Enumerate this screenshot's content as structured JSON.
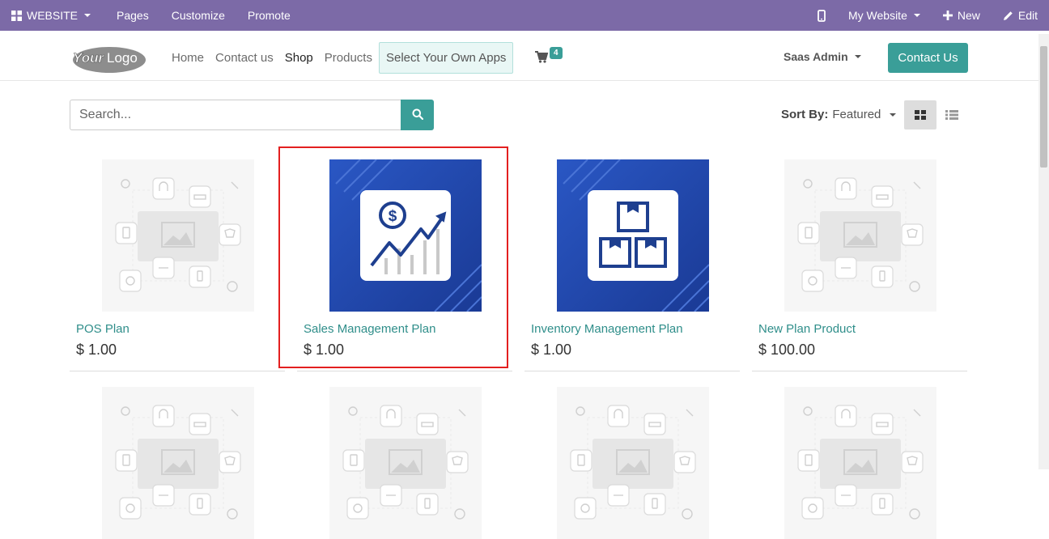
{
  "editbar": {
    "website_label": "WEBSITE",
    "menu": [
      "Pages",
      "Customize",
      "Promote"
    ],
    "my_website": "My Website",
    "new_label": "New",
    "edit_label": "Edit",
    "background": "#7c6aa7"
  },
  "header": {
    "logo_text": "YourLogo",
    "nav": [
      "Home",
      "Contact us",
      "Shop",
      "Products",
      "Select Your Own Apps"
    ],
    "active_nav": "Shop",
    "cart_count": "4",
    "user": "Saas Admin",
    "contact_button": "Contact Us",
    "accent": "#3a9e98"
  },
  "search": {
    "placeholder": "Search..."
  },
  "sort": {
    "label": "Sort By:",
    "value": "Featured"
  },
  "products": [
    {
      "name": "POS Plan",
      "price": "$ 1.00",
      "image": "placeholder"
    },
    {
      "name": "Sales Management Plan",
      "price": "$ 1.00",
      "image": "sales-chart-icon"
    },
    {
      "name": "Inventory Management Plan",
      "price": "$ 1.00",
      "image": "boxes-icon"
    },
    {
      "name": "New Plan Product",
      "price": "$ 100.00",
      "image": "placeholder"
    }
  ]
}
